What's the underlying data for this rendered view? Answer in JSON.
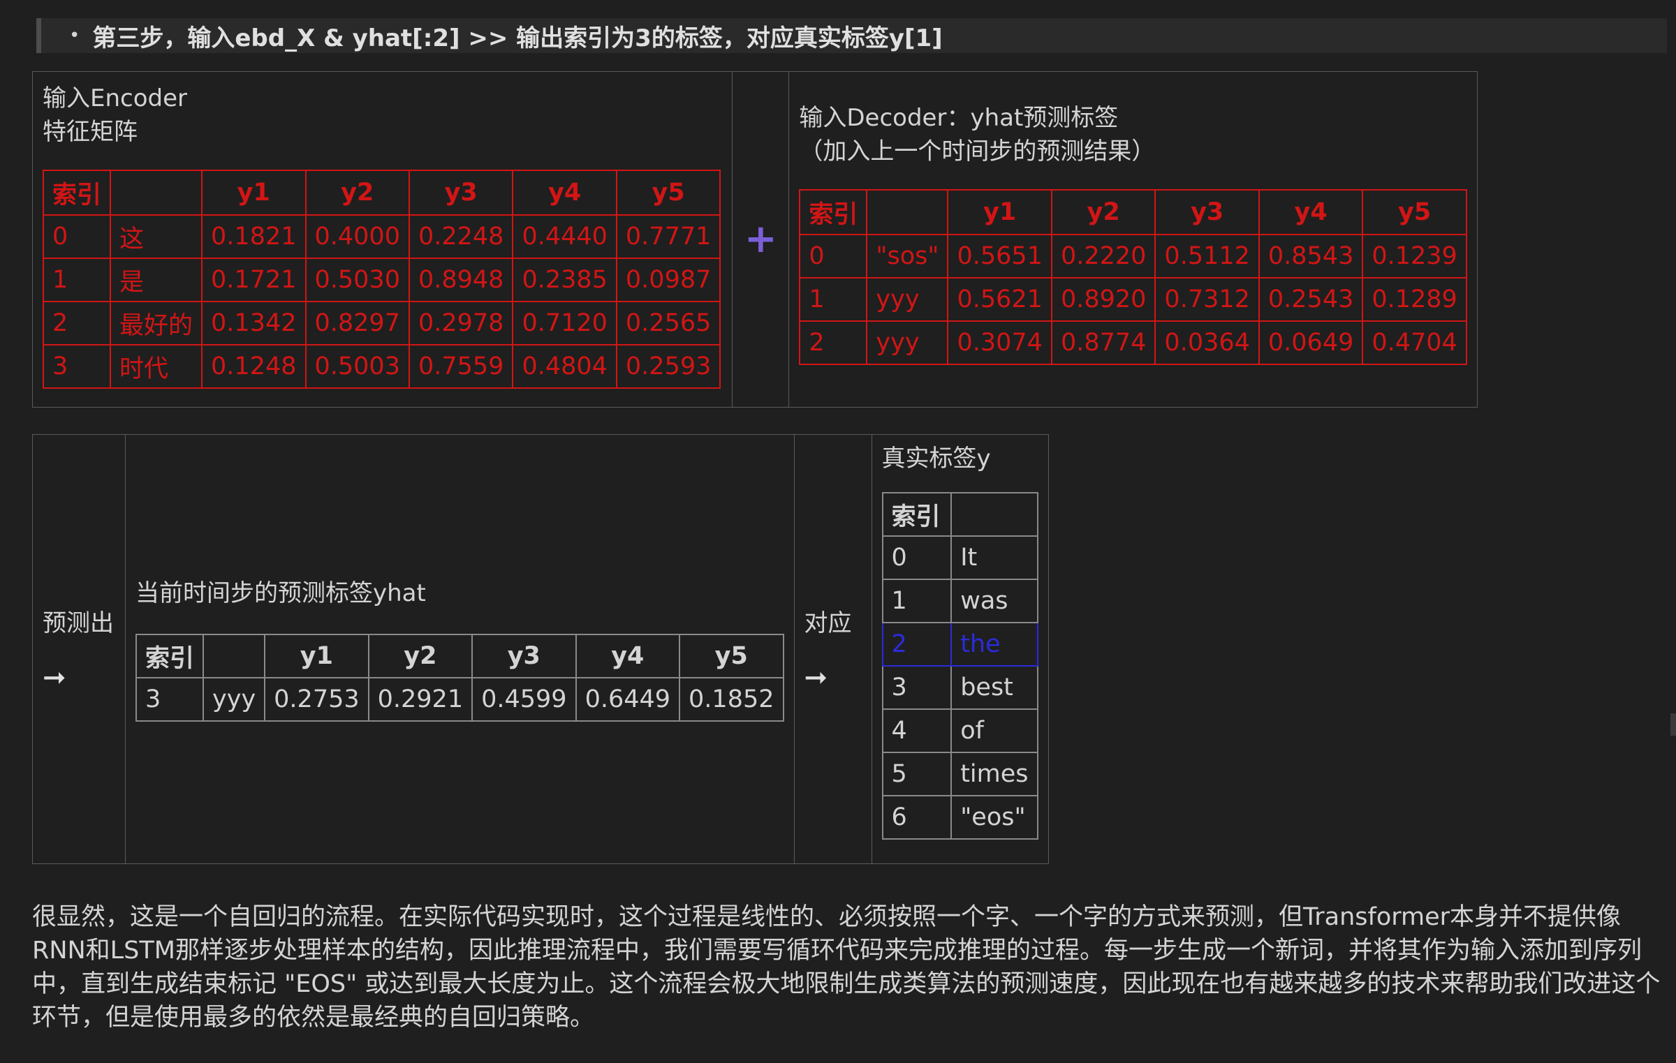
{
  "step": {
    "bullet": "•",
    "text": "第三步，输入ebd_X & yhat[:2] >> 输出索引为3的标签，对应真实标签y[1]"
  },
  "encoder": {
    "label_line1": "输入Encoder",
    "label_line2": "特征矩阵",
    "headers": [
      "索引",
      "",
      "y1",
      "y2",
      "y3",
      "y4",
      "y5"
    ],
    "rows": [
      [
        "0",
        "这",
        "0.1821",
        "0.4000",
        "0.2248",
        "0.4440",
        "0.7771"
      ],
      [
        "1",
        "是",
        "0.1721",
        "0.5030",
        "0.8948",
        "0.2385",
        "0.0987"
      ],
      [
        "2",
        "最好的",
        "0.1342",
        "0.8297",
        "0.2978",
        "0.7120",
        "0.2565"
      ],
      [
        "3",
        "时代",
        "0.1248",
        "0.5003",
        "0.7559",
        "0.4804",
        "0.2593"
      ]
    ]
  },
  "plus_symbol": "+",
  "decoder": {
    "label_line1": "输入Decoder：yhat预测标签",
    "label_line2": "（加入上一个时间步的预测结果）",
    "headers": [
      "索引",
      "",
      "y1",
      "y2",
      "y3",
      "y4",
      "y5"
    ],
    "rows": [
      [
        "0",
        "\"sos\"",
        "0.5651",
        "0.2220",
        "0.5112",
        "0.8543",
        "0.1239"
      ],
      [
        "1",
        "yyy",
        "0.5621",
        "0.8920",
        "0.7312",
        "0.2543",
        "0.1289"
      ],
      [
        "2",
        "yyy",
        "0.3074",
        "0.8774",
        "0.0364",
        "0.0649",
        "0.4704"
      ]
    ]
  },
  "predict": {
    "label": "预测出",
    "arrow": "➞"
  },
  "current": {
    "label": "当前时间步的预测标签yhat",
    "headers": [
      "索引",
      "",
      "y1",
      "y2",
      "y3",
      "y4",
      "y5"
    ],
    "rows": [
      [
        "3",
        "yyy",
        "0.2753",
        "0.2921",
        "0.4599",
        "0.6449",
        "0.1852"
      ]
    ]
  },
  "correspond": {
    "label": "对应",
    "arrow": "➞"
  },
  "truth": {
    "label": "真实标签y",
    "headers": [
      "索引",
      ""
    ],
    "rows": [
      [
        "0",
        "It"
      ],
      [
        "1",
        "was"
      ],
      [
        "2",
        "the"
      ],
      [
        "3",
        "best"
      ],
      [
        "4",
        "of"
      ],
      [
        "5",
        "times"
      ],
      [
        "6",
        "\"eos\""
      ]
    ],
    "highlight_index": 2,
    "highlight_color": "#2b2bdc"
  },
  "colors": {
    "table_red": "#d21515",
    "plus_purple": "#7b5fd6",
    "background": "#1f1f1f"
  },
  "paragraph": "很显然，这是一个自回归的流程。在实际代码实现时，这个过程是线性的、必须按照一个字、一个字的方式来预测，但Transformer本身并不提供像RNN和LSTM那样逐步处理样本的结构，因此推理流程中，我们需要写循环代码来完成推理的过程。每一步生成一个新词，并将其作为输入添加到序列中，直到生成结束标记 \"EOS\" 或达到最大长度为止。这个流程会极大地限制生成类算法的预测速度，因此现在也有越来越多的技术来帮助我们改进这个环节，但是使用最多的依然是最经典的自回归策略。"
}
